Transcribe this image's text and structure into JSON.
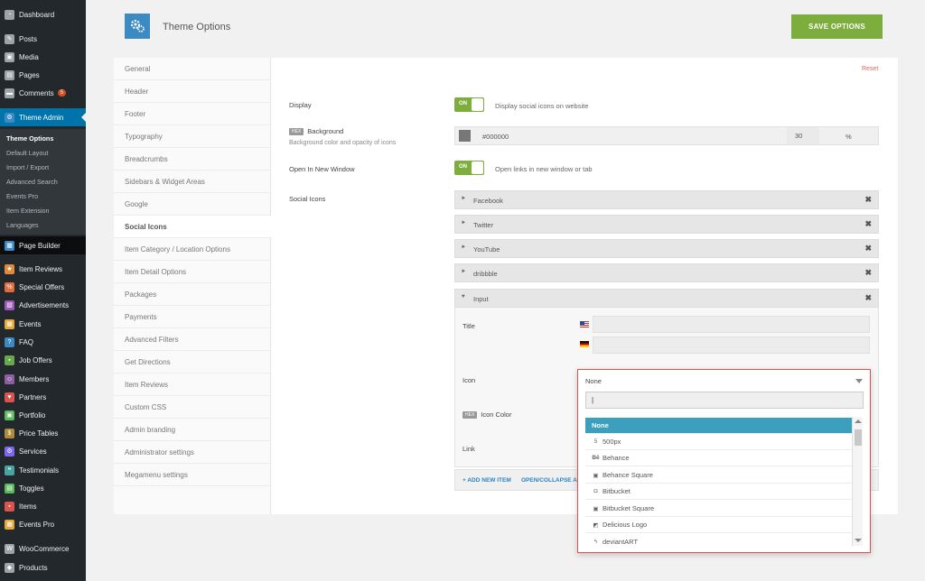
{
  "admin_menu": {
    "items": [
      {
        "label": "Dashboard",
        "icon": "dashboard-icon"
      },
      {
        "label": "Posts",
        "icon": "pin-icon"
      },
      {
        "label": "Media",
        "icon": "media-icon"
      },
      {
        "label": "Pages",
        "icon": "pages-icon"
      },
      {
        "label": "Comments",
        "icon": "comment-icon",
        "badge": "5"
      },
      {
        "label": "Theme Admin",
        "icon": "theme-admin-icon"
      },
      {
        "label": "Page Builder",
        "icon": "page-builder-icon"
      },
      {
        "label": "Item Reviews",
        "icon": "star-icon"
      },
      {
        "label": "Special Offers",
        "icon": "offers-icon"
      },
      {
        "label": "Advertisements",
        "icon": "ads-icon"
      },
      {
        "label": "Events",
        "icon": "events-icon"
      },
      {
        "label": "FAQ",
        "icon": "faq-icon"
      },
      {
        "label": "Job Offers",
        "icon": "jobs-icon"
      },
      {
        "label": "Members",
        "icon": "members-icon"
      },
      {
        "label": "Partners",
        "icon": "partners-icon"
      },
      {
        "label": "Portfolio",
        "icon": "portfolio-icon"
      },
      {
        "label": "Price Tables",
        "icon": "price-icon"
      },
      {
        "label": "Services",
        "icon": "services-icon"
      },
      {
        "label": "Testimonials",
        "icon": "testimonials-icon"
      },
      {
        "label": "Toggles",
        "icon": "toggles-icon"
      },
      {
        "label": "Items",
        "icon": "items-icon"
      },
      {
        "label": "Events Pro",
        "icon": "events-pro-icon"
      },
      {
        "label": "WooCommerce",
        "icon": "woocommerce-icon"
      },
      {
        "label": "Products",
        "icon": "products-icon"
      }
    ],
    "submenu": [
      "Theme Options",
      "Default Layout",
      "Import / Export",
      "Advanced Search",
      "Events Pro",
      "Item Extension",
      "Languages"
    ]
  },
  "header": {
    "title": "Theme Options",
    "save_label": "SAVE OPTIONS",
    "logo_icon": "gears-icon"
  },
  "options_nav": [
    "General",
    "Header",
    "Footer",
    "Typography",
    "Breadcrumbs",
    "Sidebars & Widget Areas",
    "Google",
    "Social Icons",
    "Item Category / Location Options",
    "Item Detail Options",
    "Packages",
    "Payments",
    "Advanced Filters",
    "Get Directions",
    "Item Reviews",
    "Custom CSS",
    "Admin branding",
    "Administrator settings",
    "Megamenu settings"
  ],
  "content": {
    "reset_label": "Reset",
    "display": {
      "label": "Display",
      "toggle": "ON",
      "description": "Display social icons on website"
    },
    "background": {
      "tag": "HEX",
      "label": "Background",
      "description": "Background color and opacity of icons",
      "hex": "#000000",
      "opacity": "30",
      "unit": "%"
    },
    "open_new_window": {
      "label": "Open In New Window",
      "toggle": "ON",
      "description": "Open links in new window or tab"
    },
    "social_icons_label": "Social Icons",
    "accordions": [
      "Facebook",
      "Twitter",
      "YouTube",
      "dribbble",
      "Input"
    ],
    "input_item": {
      "title_label": "Title",
      "icon_label": "Icon",
      "icon_color_tag": "HEX",
      "icon_color_label": "Icon Color",
      "link_label": "Link"
    },
    "footer": {
      "add_label": "+ ADD NEW ITEM",
      "open_collapse_label": "OPEN/COLLAPSE ALL"
    }
  },
  "dropdown": {
    "selected": "None",
    "search_value": "|",
    "options": [
      {
        "label": "None",
        "icon": ""
      },
      {
        "label": "500px",
        "icon": "500px-icon"
      },
      {
        "label": "Behance",
        "icon": "behance-icon"
      },
      {
        "label": "Behance Square",
        "icon": "behance-square-icon"
      },
      {
        "label": "Bitbucket",
        "icon": "bitbucket-icon"
      },
      {
        "label": "Bitbucket Square",
        "icon": "bitbucket-square-icon"
      },
      {
        "label": "Delicious Logo",
        "icon": "delicious-icon"
      },
      {
        "label": "deviantART",
        "icon": "deviantart-icon"
      }
    ]
  },
  "colors": {
    "accent_blue": "#0073aa",
    "save_green": "#7cad3d",
    "selected_option": "#3b9fbd",
    "dropdown_border": "#d9534f"
  }
}
